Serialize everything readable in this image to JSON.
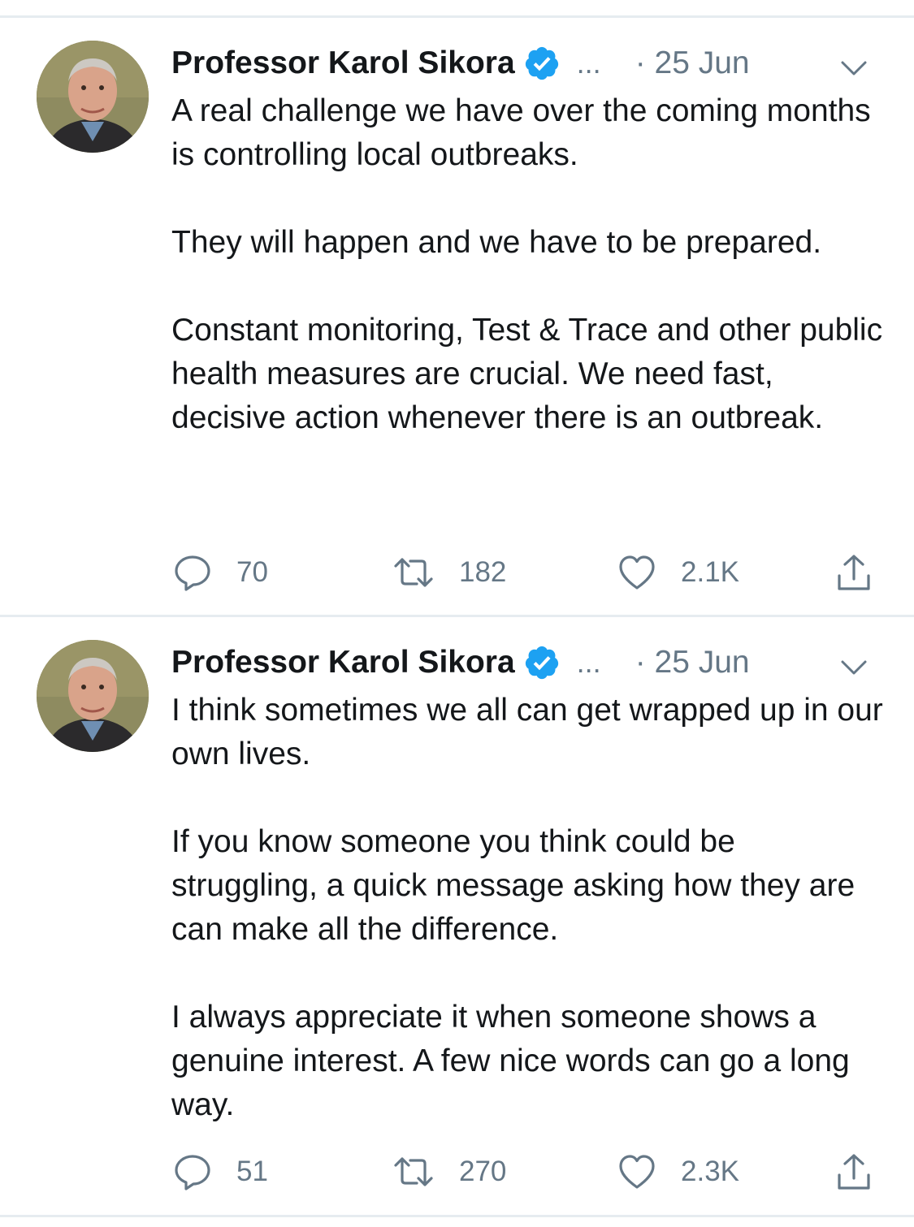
{
  "tweets": [
    {
      "author_name": "Professor Karol Sikora",
      "handle_truncation": "...",
      "date": "· 25 Jun",
      "paragraphs": [
        "A real challenge we have over the coming months is controlling local outbreaks.",
        "They will happen and we have to be prepared.",
        "Constant monitoring, Test & Trace and other public health measures are crucial. We need fast, decisive action whenever there is an outbreak."
      ],
      "replies": "70",
      "retweets": "182",
      "likes": "2.1K"
    },
    {
      "author_name": "Professor Karol Sikora",
      "handle_truncation": "...",
      "date": "· 25 Jun",
      "paragraphs": [
        "I think sometimes we all can get wrapped up in our own lives.",
        "If you know someone you think could be struggling, a quick message asking how they are can make all the difference.",
        "I always appreciate it when someone shows a genuine interest. A few nice words can go a long way."
      ],
      "replies": "51",
      "retweets": "270",
      "likes": "2.3K"
    }
  ],
  "icons": {
    "verified": "verified-badge-icon",
    "caret": "chevron-down-icon",
    "reply": "reply-bubble-icon",
    "retweet": "retweet-arrows-icon",
    "like": "heart-icon",
    "share": "share-upload-icon"
  },
  "colors": {
    "text": "#14171a",
    "secondary": "#657786",
    "verified": "#1da1f2",
    "divider": "#e6ecf0"
  }
}
